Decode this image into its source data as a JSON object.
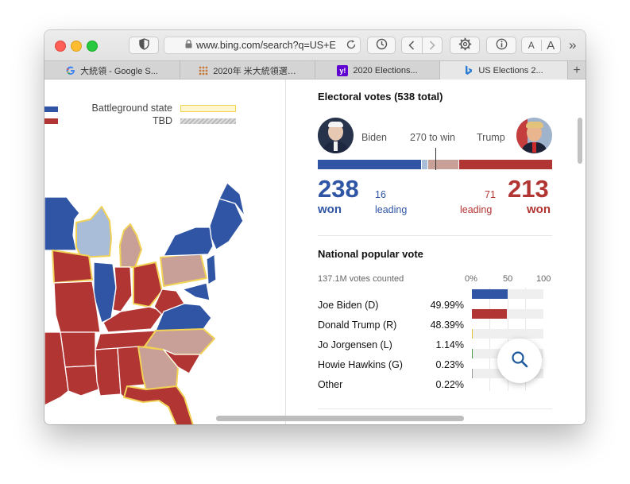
{
  "browser": {
    "url": "www.bing.com/search?q=US+E",
    "text_size_small": "A",
    "text_size_large": "A",
    "more_glyph": "»",
    "tabs": [
      {
        "label": "大統領 - Google S...",
        "favicon": "google"
      },
      {
        "label": "2020年 米大統領選…",
        "favicon": "grid"
      },
      {
        "label": "2020 Elections...",
        "favicon": "yahoo"
      },
      {
        "label": "US Elections 2...",
        "favicon": "bing",
        "active": true
      }
    ],
    "new_tab_glyph": "+"
  },
  "map": {
    "legend": [
      {
        "label": "Battleground state"
      },
      {
        "label": "TBD"
      }
    ],
    "colors": {
      "dem": "#2f55a4",
      "rep": "#b13532",
      "lean_dem": "#a9bdd8",
      "lean_rep": "#c8a097",
      "battleground": "#f1d257"
    }
  },
  "electoral": {
    "title": "Electoral votes (538 total)",
    "dem_name": "Biden",
    "rep_name": "Trump",
    "threshold_label": "270 to win",
    "dem_won": "238",
    "dem_won_label": "won",
    "dem_leading": "16",
    "dem_leading_label": "leading",
    "rep_won": "213",
    "rep_won_label": "won",
    "rep_leading": "71",
    "rep_leading_label": "leading",
    "total": 538,
    "colors": {
      "dem": "#2f55a4",
      "dem_lead": "#a9bdd8",
      "rep": "#b13532",
      "rep_lead": "#c8a097"
    }
  },
  "popular": {
    "title": "National popular vote",
    "counted": "137.1M votes counted",
    "ticks": [
      "0%",
      "50",
      "100"
    ],
    "rows": [
      {
        "name": "Joe Biden (D)",
        "pct": "49.99%",
        "value": 49.99,
        "color": "#2f55a4"
      },
      {
        "name": "Donald Trump (R)",
        "pct": "48.39%",
        "value": 48.39,
        "color": "#b13532"
      },
      {
        "name": "Jo Jorgensen (L)",
        "pct": "1.14%",
        "value": 1.14,
        "color": "#e8c040"
      },
      {
        "name": "Howie Hawkins (G)",
        "pct": "0.23%",
        "value": 0.23,
        "color": "#4a9a4a"
      },
      {
        "name": "Other",
        "pct": "0.22%",
        "value": 0.22,
        "color": "#999999"
      }
    ]
  }
}
